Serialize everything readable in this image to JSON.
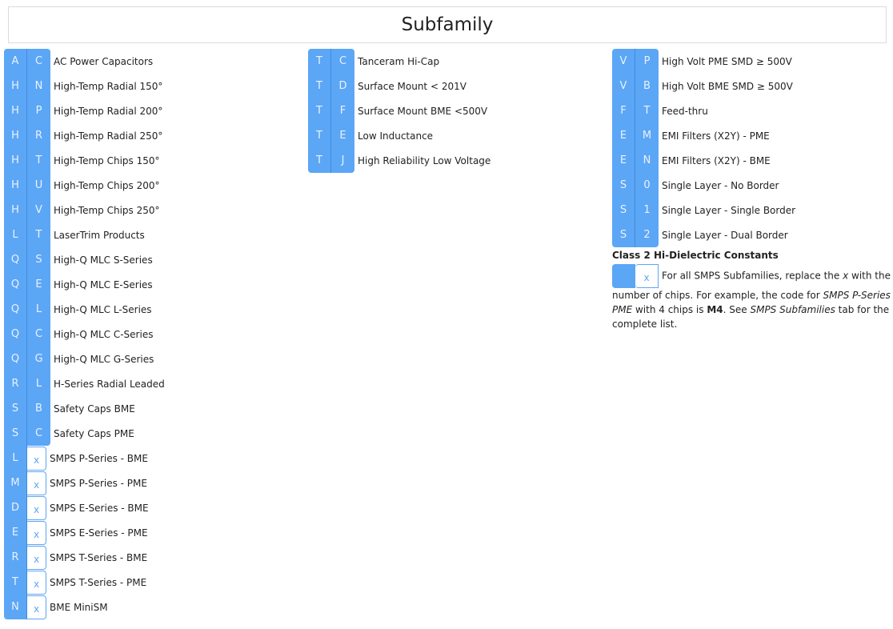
{
  "title": "Subfamily",
  "columns": [
    {
      "rows": [
        {
          "a": "A",
          "b": "C",
          "label": "AC Power Capacitors"
        },
        {
          "a": "H",
          "b": "N",
          "label": "High-Temp Radial 150°"
        },
        {
          "a": "H",
          "b": "P",
          "label": "High-Temp Radial 200°"
        },
        {
          "a": "H",
          "b": "R",
          "label": "High-Temp Radial 250°"
        },
        {
          "a": "H",
          "b": "T",
          "label": "High-Temp Chips 150°"
        },
        {
          "a": "H",
          "b": "U",
          "label": "High-Temp Chips 200°"
        },
        {
          "a": "H",
          "b": "V",
          "label": "High-Temp Chips 250°"
        },
        {
          "a": "L",
          "b": "T",
          "label": "LaserTrim Products"
        },
        {
          "a": "Q",
          "b": "S",
          "label": "High-Q MLC S-Series"
        },
        {
          "a": "Q",
          "b": "E",
          "label": "High-Q MLC E-Series"
        },
        {
          "a": "Q",
          "b": "L",
          "label": "High-Q MLC L-Series"
        },
        {
          "a": "Q",
          "b": "C",
          "label": "High-Q MLC C-Series"
        },
        {
          "a": "Q",
          "b": "G",
          "label": "High-Q MLC G-Series"
        },
        {
          "a": "R",
          "b": "L",
          "label": "H-Series Radial Leaded"
        },
        {
          "a": "S",
          "b": "B",
          "label": "Safety Caps BME"
        },
        {
          "a": "S",
          "b": "C",
          "label": "Safety Caps PME"
        },
        {
          "a": "L",
          "b": "x",
          "label": "SMPS P-Series - BME",
          "placeholder": true
        },
        {
          "a": "M",
          "b": "x",
          "label": "SMPS P-Series - PME",
          "placeholder": true
        },
        {
          "a": "D",
          "b": "x",
          "label": "SMPS E-Series - BME",
          "placeholder": true
        },
        {
          "a": "E",
          "b": "x",
          "label": "SMPS E-Series - PME",
          "placeholder": true
        },
        {
          "a": "R",
          "b": "x",
          "label": "SMPS T-Series - BME",
          "placeholder": true
        },
        {
          "a": "T",
          "b": "x",
          "label": "SMPS T-Series - PME",
          "placeholder": true
        },
        {
          "a": "N",
          "b": "x",
          "label": "BME MiniSM",
          "placeholder": true
        }
      ]
    },
    {
      "rows": [
        {
          "a": "T",
          "b": "C",
          "label": "Tanceram Hi-Cap"
        },
        {
          "a": "T",
          "b": "D",
          "label": "Surface Mount < 201V"
        },
        {
          "a": "T",
          "b": "F",
          "label": "Surface Mount BME <500V"
        },
        {
          "a": "T",
          "b": "E",
          "label": "Low Inductance"
        },
        {
          "a": "T",
          "b": "J",
          "label": "High Reliability Low Voltage"
        }
      ]
    },
    {
      "rows": [
        {
          "a": "V",
          "b": "P",
          "label": "High Volt PME SMD ≥ 500V"
        },
        {
          "a": "V",
          "b": "B",
          "label": "High Volt BME SMD ≥ 500V"
        },
        {
          "a": "F",
          "b": "T",
          "label": "Feed-thru"
        },
        {
          "a": "E",
          "b": "M",
          "label": "EMI Filters (X2Y) - PME"
        },
        {
          "a": "E",
          "b": "N",
          "label": "EMI Filters (X2Y) - BME"
        },
        {
          "a": "S",
          "b": "0",
          "label": "Single Layer - No Border"
        },
        {
          "a": "S",
          "b": "1",
          "label": "Single Layer - Single Border"
        },
        {
          "a": "S",
          "b": "2",
          "label": "Single Layer - Dual Border"
        }
      ]
    }
  ],
  "legend": {
    "heading": "Class 2 Hi-Dielectric Constants",
    "placeholder_char": "x",
    "note_parts": [
      {
        "text": "For all SMPS Subfamilies, replace the ",
        "style": "normal"
      },
      {
        "text": "x",
        "style": "italic"
      },
      {
        "text": " with the number of chips. For example, the code for ",
        "style": "normal"
      },
      {
        "text": "SMPS P-Series PME",
        "style": "italic"
      },
      {
        "text": " with 4 chips is ",
        "style": "normal"
      },
      {
        "text": "M4",
        "style": "bold"
      },
      {
        "text": ". See ",
        "style": "normal"
      },
      {
        "text": "SMPS Subfamilies",
        "style": "italic"
      },
      {
        "text": " tab for the complete list.",
        "style": "normal"
      }
    ]
  },
  "colors": {
    "accent": "#5ca6f6",
    "separator": "#3d8be0"
  }
}
